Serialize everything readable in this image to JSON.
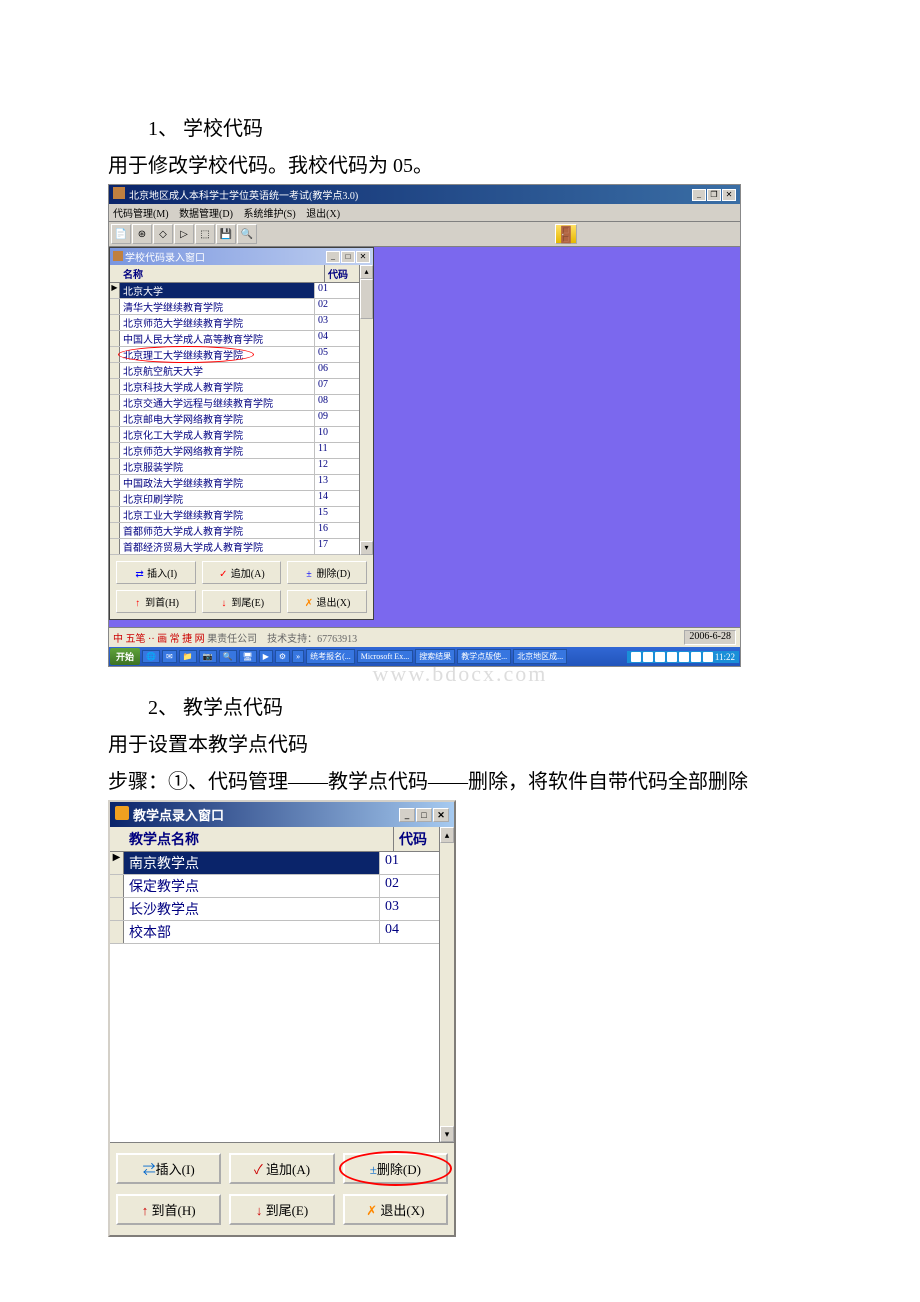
{
  "doc": {
    "heading1": "1、 学校代码",
    "desc1": "用于修改学校代码。我校代码为 05。",
    "heading2": "2、 教学点代码",
    "desc2": "用于设置本教学点代码",
    "desc3": "步骤：①、代码管理——教学点代码——删除，将软件自带代码全部删除",
    "watermark": "www.bdocx.com"
  },
  "app1": {
    "title": "北京地区成人本科学士学位英语统一考试(教学点3.0)",
    "menus": {
      "m1": "代码管理(M)",
      "m2": "数据管理(D)",
      "m3": "系统维护(S)",
      "m4": "退出(X)"
    },
    "subwin_title": "学校代码录入窗口",
    "col_name": "名称",
    "col_code": "代码",
    "rows": [
      {
        "name": "北京大学",
        "code": "01",
        "sel": true
      },
      {
        "name": "清华大学继续教育学院",
        "code": "02"
      },
      {
        "name": "北京师范大学继续教育学院",
        "code": "03"
      },
      {
        "name": "中国人民大学成人高等教育学院",
        "code": "04"
      },
      {
        "name": "北京理工大学继续教育学院",
        "code": "05",
        "hl": true
      },
      {
        "name": "北京航空航天大学",
        "code": "06"
      },
      {
        "name": "北京科技大学成人教育学院",
        "code": "07"
      },
      {
        "name": "北京交通大学远程与继续教育学院",
        "code": "08"
      },
      {
        "name": "北京邮电大学网络教育学院",
        "code": "09"
      },
      {
        "name": "北京化工大学成人教育学院",
        "code": "10"
      },
      {
        "name": "北京师范大学网络教育学院",
        "code": "11"
      },
      {
        "name": "北京服装学院",
        "code": "12"
      },
      {
        "name": "中国政法大学继续教育学院",
        "code": "13"
      },
      {
        "name": "北京印刷学院",
        "code": "14"
      },
      {
        "name": "北京工业大学继续教育学院",
        "code": "15"
      },
      {
        "name": "首都师范大学成人教育学院",
        "code": "16"
      },
      {
        "name": "首都经济贸易大学成人教育学院",
        "code": "17"
      }
    ],
    "buttons": {
      "insert": "插入(I)",
      "append": "追加(A)",
      "delete": "删除(D)",
      "first": "到首(H)",
      "last": "到尾(E)",
      "exit": "退出(X)"
    },
    "status_left_prefix": "中 五笔 ·· 画 常 捷 网",
    "status_left": " 果责任公司　技术支持：67763913",
    "status_date": "2006-6-28",
    "taskbar": {
      "start": "开始",
      "items": [
        "统考报名(...",
        "Microsoft Ex...",
        "搜索结果",
        "教学点版使...",
        "北京地区成..."
      ],
      "time": "11:22"
    }
  },
  "app2": {
    "title": "教学点录入窗口",
    "col_name": "教学点名称",
    "col_code": "代码",
    "rows": [
      {
        "name": "南京教学点",
        "code": "01",
        "sel": true
      },
      {
        "name": "保定教学点",
        "code": "02"
      },
      {
        "name": "长沙教学点",
        "code": "03"
      },
      {
        "name": "校本部",
        "code": "04"
      }
    ],
    "buttons": {
      "insert": "插入(I)",
      "append": "追加(A)",
      "delete": "删除(D)",
      "first": "到首(H)",
      "last": "到尾(E)",
      "exit": "退出(X)"
    }
  }
}
